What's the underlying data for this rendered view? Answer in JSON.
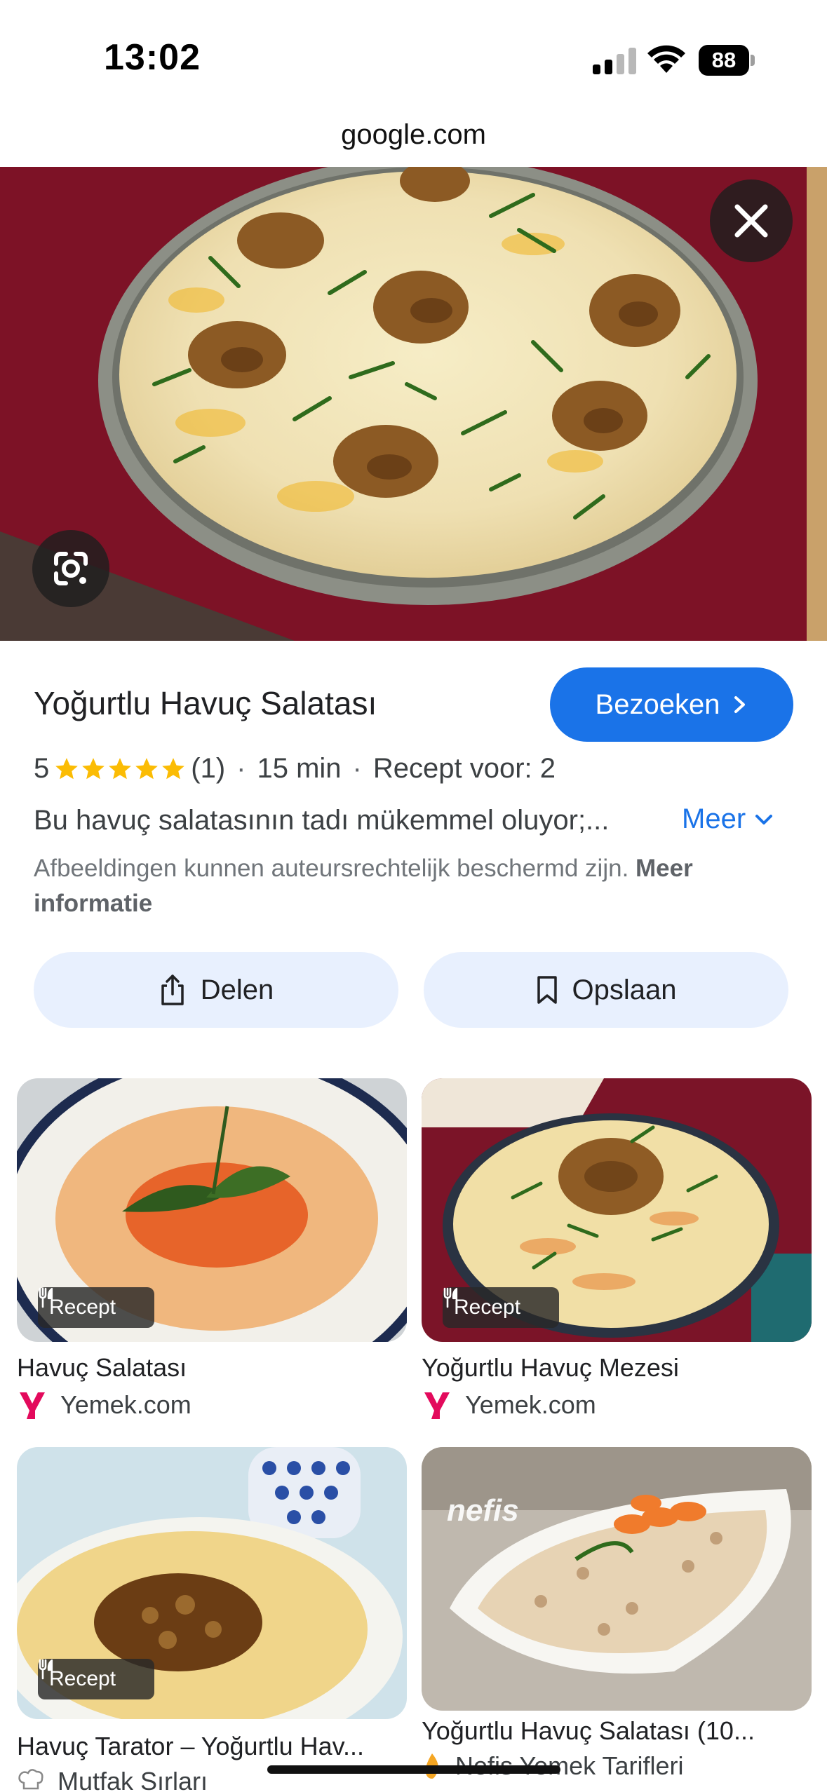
{
  "status_bar": {
    "time": "13:02",
    "battery": "88"
  },
  "browser": {
    "url": "google.com"
  },
  "hero": {
    "close_icon": "close-icon",
    "lens_icon": "google-lens-icon"
  },
  "result": {
    "title": "Yoğurtlu Havuç Salatası",
    "visit_label": "Bezoeken",
    "rating_value": "5",
    "stars": 5,
    "rating_count": "(1)",
    "duration": "15 min",
    "servings": "Recept voor: 2",
    "description": "Bu havuç salatasının tadı mükemmel oluyor;...",
    "more_label": "Meer",
    "copyright_text": "Afbeeldingen kunnen auteursrechtelijk beschermd zijn.",
    "copyright_link": "Meer informatie"
  },
  "actions": {
    "share_label": "Delen",
    "save_label": "Opslaan"
  },
  "related": [
    {
      "badge": "Recept",
      "title": "Havuç Salatası",
      "source": "Yemek.com"
    },
    {
      "badge": "Recept",
      "title": "Yoğurtlu Havuç Mezesi",
      "source": "Yemek.com"
    },
    {
      "badge": "Recept",
      "title": "Havuç Tarator – Yoğurtlu Hav...",
      "source": "Mutfak Sırları"
    },
    {
      "badge": "",
      "title": "Yoğurtlu Havuç Salatası (10...",
      "source": "Nefis Yemek Tarifleri",
      "watermark": "nefis"
    }
  ],
  "colors": {
    "accent": "#1a73e8",
    "action_bg": "#e8f0fe",
    "star": "#fbbc04",
    "yemek_brand": "#e30a5c"
  }
}
